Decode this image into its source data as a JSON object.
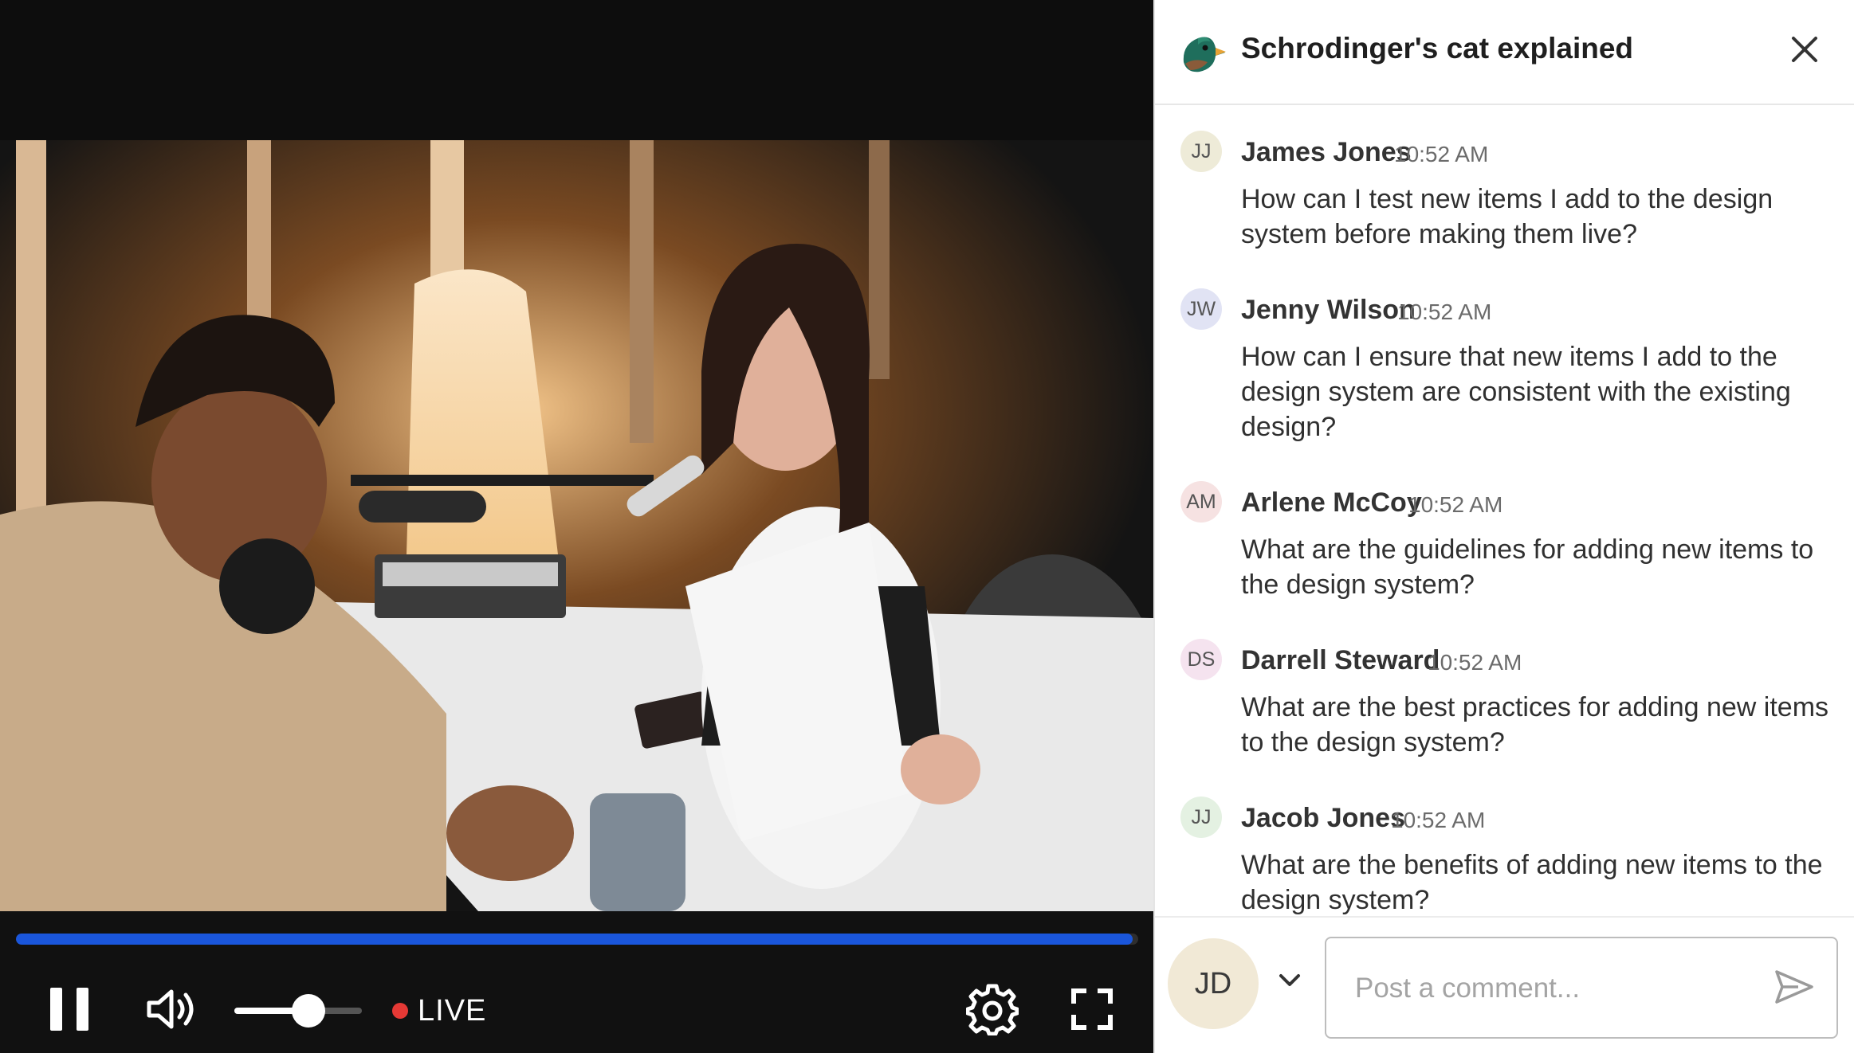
{
  "video": {
    "progress_fraction": 0.995,
    "volume_fraction": 0.58,
    "live_label": "LIVE",
    "icons": {
      "pause": "pause-icon",
      "volume": "volume-icon",
      "settings": "gear-icon",
      "fullscreen": "fullscreen-icon"
    }
  },
  "chat": {
    "title": "Schrodinger's cat explained",
    "messages": [
      {
        "initials": "JJ",
        "avatar_color": "#eeebd8",
        "name": "James Jones",
        "time": "10:52 AM",
        "text": "How can I test new items I add to the design system before making them live?"
      },
      {
        "initials": "JW",
        "avatar_color": "#e1e3f4",
        "name": "Jenny Wilson",
        "time": "10:52 AM",
        "text": "How can I ensure that new items I add to the design system are consistent with the existing design?"
      },
      {
        "initials": "AM",
        "avatar_color": "#f6e2e2",
        "name": "Arlene McCoy",
        "time": "10:52 AM",
        "text": "What are the guidelines for adding new items to the design system?"
      },
      {
        "initials": "DS",
        "avatar_color": "#f5e3ef",
        "name": "Darrell Steward",
        "time": "10:52 AM",
        "text": "What are the best practices for adding new items to the design system?"
      },
      {
        "initials": "JJ",
        "avatar_color": "#e4f1e2",
        "name": "Jacob Jones",
        "time": "10:52 AM",
        "text": "What are the benefits of adding new items to the design system?"
      }
    ],
    "composer": {
      "user_initials": "JD",
      "placeholder": "Post a comment..."
    }
  }
}
